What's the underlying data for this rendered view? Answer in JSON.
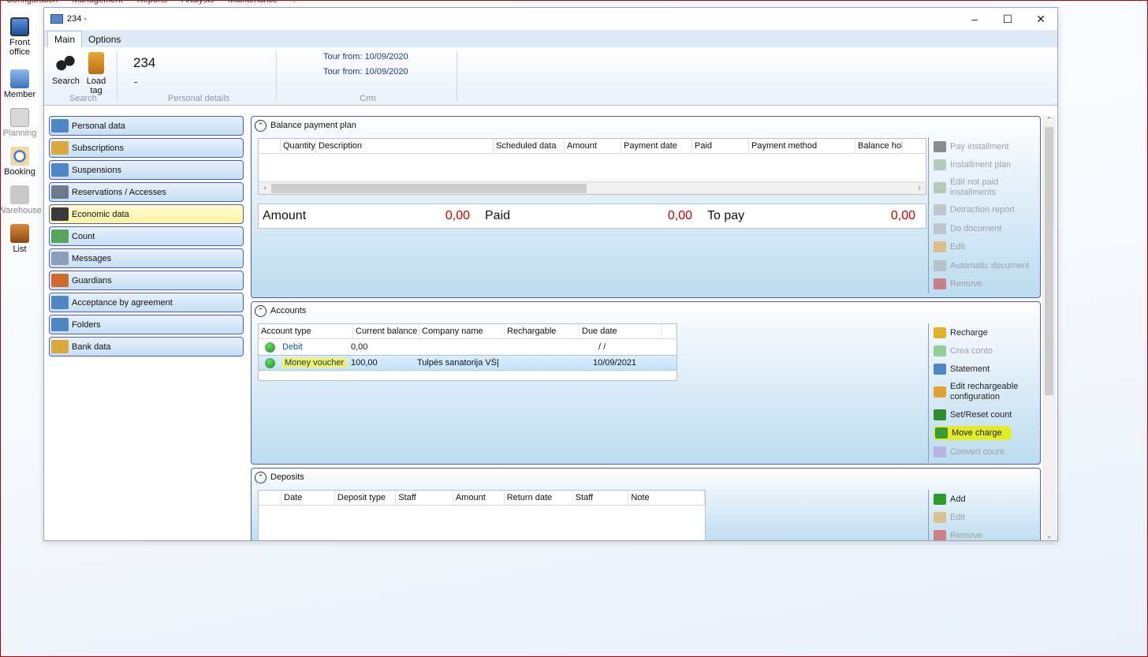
{
  "app_menu": [
    "Configuration",
    "Management",
    "Reports",
    "Analysis",
    "Maintenance",
    "?"
  ],
  "left_bar": [
    {
      "label": "Front office",
      "icon": "monitor-icon",
      "enabled": true
    },
    {
      "label": "Member",
      "icon": "member-card-icon",
      "enabled": true
    },
    {
      "label": "Planning",
      "icon": "calendar-icon",
      "enabled": false
    },
    {
      "label": "Booking",
      "icon": "booking-clock-icon",
      "enabled": true
    },
    {
      "label": "Warehouse",
      "icon": "warehouse-icon",
      "enabled": false
    },
    {
      "label": "List",
      "icon": "list-briefcase-icon",
      "enabled": true
    }
  ],
  "window": {
    "title": "234 -",
    "controls": {
      "minimize": "–",
      "maximize": "☐",
      "close": "✕"
    }
  },
  "ribbon": {
    "tabs": [
      "Main",
      "Options"
    ],
    "search_label": "Search",
    "load_tag_label": "Load tag",
    "group_search": "Search",
    "member_id": "234",
    "member_name": "-",
    "group_personal": "Personal details",
    "crm_lines": [
      "Tour from: 10/09/2020",
      "Tour from: 10/09/2020"
    ],
    "group_crm": "Crm"
  },
  "nav": [
    {
      "label": "Personal data",
      "icon": "id-card-icon",
      "color": "#4f86c6"
    },
    {
      "label": "Subscriptions",
      "icon": "ticket-icon",
      "color": "#d9a93c"
    },
    {
      "label": "Suspensions",
      "icon": "warning-card-icon",
      "color": "#4f86c6"
    },
    {
      "label": "Reservations / Accesses",
      "icon": "checklist-icon",
      "color": "#6b7a8c"
    },
    {
      "label": "Economic data",
      "icon": "wallet-icon",
      "color": "#3a3a3a"
    },
    {
      "label": "Count",
      "icon": "money-icon",
      "color": "#5aa35a"
    },
    {
      "label": "Messages",
      "icon": "message-icon",
      "color": "#8aa0b8"
    },
    {
      "label": "Guardians",
      "icon": "people-icon",
      "color": "#d06a2a"
    },
    {
      "label": "Acceptance by agreement",
      "icon": "agreement-card-icon",
      "color": "#4f86c6"
    },
    {
      "label": "Folders",
      "icon": "stethoscope-icon",
      "color": "#4f86c6"
    },
    {
      "label": "Bank data",
      "icon": "bank-icon",
      "color": "#d9a93c"
    }
  ],
  "nav_active_index": 4,
  "balance": {
    "title": "Balance payment plan",
    "columns": [
      "",
      "Quantity",
      "Description",
      "Scheduled data",
      "Amount",
      "Payment date",
      "Paid",
      "Payment method",
      "Balance hold"
    ],
    "amount_label": "Amount",
    "amount_value": "0,00",
    "paid_label": "Paid",
    "paid_value": "0,00",
    "to_pay_label": "To pay",
    "to_pay_value": "0,00",
    "actions": [
      {
        "label": "Pay installment",
        "icon": "pay-icon",
        "enabled": false,
        "color": "#333"
      },
      {
        "label": "Installment plan",
        "icon": "plan-icon",
        "enabled": false,
        "color": "#8a8"
      },
      {
        "label": "Edit not paid installments",
        "icon": "edit-plan-icon",
        "enabled": false,
        "color": "#8a8"
      },
      {
        "label": "Detraction report",
        "icon": "report-icon",
        "enabled": false,
        "color": "#aaa"
      },
      {
        "label": "Do document",
        "icon": "document-icon",
        "enabled": false,
        "color": "#aaa"
      },
      {
        "label": "Edit",
        "icon": "edit-icon",
        "enabled": false,
        "color": "#e3a13a"
      },
      {
        "label": "Automatic document",
        "icon": "auto-document-icon",
        "enabled": false,
        "color": "#aaa"
      },
      {
        "label": "Remove",
        "icon": "remove-icon",
        "enabled": false,
        "color": "#c33"
      }
    ]
  },
  "accounts": {
    "title": "Accounts",
    "columns": [
      "Account type",
      "Current balance",
      "Company name",
      "Rechargable",
      "Due date"
    ],
    "rows": [
      {
        "type": "Debit",
        "balance": "0,00",
        "company": "",
        "rechargable": "",
        "due": "/ /"
      },
      {
        "type": "Money voucher",
        "balance": "100,00",
        "company": "Tulpės sanatorija VŠ|",
        "rechargable": "",
        "due": "10/09/2021"
      }
    ],
    "actions": [
      {
        "label": "Recharge",
        "icon": "recharge-icon",
        "enabled": true,
        "color": "#e0b030"
      },
      {
        "label": "Crea conto",
        "icon": "add-account-icon",
        "enabled": false,
        "color": "#4caf50"
      },
      {
        "label": "Statement",
        "icon": "statement-icon",
        "enabled": true,
        "color": "#4f86c6"
      },
      {
        "label": "Edit rechargeable configuration",
        "icon": "edit-config-icon",
        "enabled": true,
        "color": "#e3a13a"
      },
      {
        "label": "Set/Reset count",
        "icon": "checkmark-icon",
        "enabled": true,
        "color": "#2e8b2e"
      },
      {
        "label": "Move charge",
        "icon": "move-charge-icon",
        "enabled": true,
        "color": "#3a9a3a"
      },
      {
        "label": "Convert count",
        "icon": "convert-icon",
        "enabled": false,
        "color": "#b090e0"
      }
    ]
  },
  "deposits": {
    "title": "Deposits",
    "columns": [
      "",
      "Date",
      "Deposit type",
      "Staff",
      "Amount",
      "Return date",
      "Staff",
      "Note"
    ],
    "actions": [
      {
        "label": "Add",
        "icon": "add-icon",
        "enabled": true,
        "color": "#2e9a2e"
      },
      {
        "label": "Edit",
        "icon": "edit-icon",
        "enabled": false,
        "color": "#e3a13a"
      },
      {
        "label": "Remove",
        "icon": "remove-icon",
        "enabled": false,
        "color": "#c33"
      }
    ]
  }
}
